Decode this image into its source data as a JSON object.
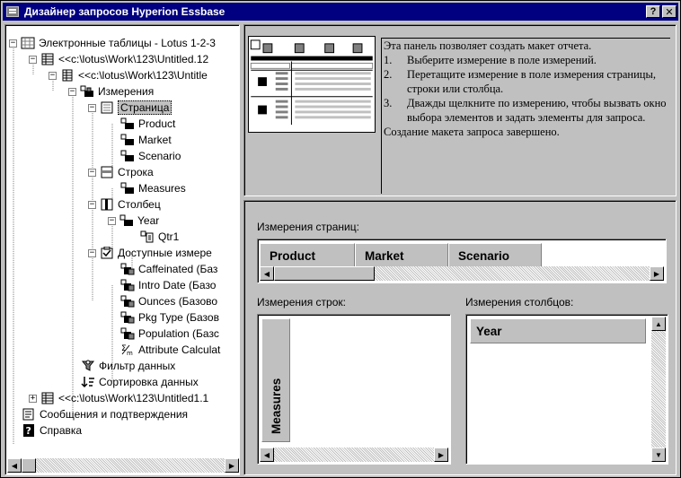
{
  "window": {
    "title": "Дизайнер запросов Hyperion Essbase",
    "help_button": "?",
    "close_button": "✕"
  },
  "tree": {
    "nodes": [
      {
        "label": "Электронные таблицы - Lotus 1-2-3",
        "icon": "spreadsheet-app-icon"
      },
      {
        "label": "<<c:\\lotus\\Work\\123\\Untitled.12",
        "icon": "workbook-icon"
      },
      {
        "label": "<<c:\\lotus\\Work\\123\\Untitle",
        "icon": "sheet-icon"
      },
      {
        "label": "Измерения",
        "icon": "dimensions-icon"
      },
      {
        "label": "Страница",
        "icon": "page-icon"
      },
      {
        "label": "Product",
        "icon": "dimension-icon"
      },
      {
        "label": "Market",
        "icon": "dimension-icon"
      },
      {
        "label": "Scenario",
        "icon": "dimension-icon"
      },
      {
        "label": "Строка",
        "icon": "row-icon"
      },
      {
        "label": "Measures",
        "icon": "dimension-icon"
      },
      {
        "label": "Столбец",
        "icon": "column-icon"
      },
      {
        "label": "Year",
        "icon": "dimension-icon"
      },
      {
        "label": "Qtr1",
        "icon": "member-icon"
      },
      {
        "label": "Доступные измере",
        "icon": "available-dimensions-icon"
      },
      {
        "label": "Caffeinated (Баз",
        "icon": "attribute-dimension-icon"
      },
      {
        "label": "Intro Date (Базо",
        "icon": "attribute-dimension-icon"
      },
      {
        "label": "Ounces (Базово",
        "icon": "attribute-dimension-icon"
      },
      {
        "label": "Pkg Type (Базов",
        "icon": "attribute-dimension-icon"
      },
      {
        "label": "Population (Базс",
        "icon": "attribute-dimension-icon"
      },
      {
        "label": "Attribute Calculat",
        "icon": "attribute-calculation-icon"
      },
      {
        "label": "Фильтр данных",
        "icon": "filter-icon"
      },
      {
        "label": "Сортировка данных",
        "icon": "sort-icon"
      },
      {
        "label": "<<c:\\lotus\\Work\\123\\Untitled1.1",
        "icon": "workbook-icon"
      },
      {
        "label": "Сообщения и подтверждения",
        "icon": "messages-icon"
      },
      {
        "label": "Справка",
        "icon": "help-icon"
      }
    ]
  },
  "help": {
    "intro": "Эта панель позволяет создать макет отчета.",
    "steps": [
      {
        "num": "1.",
        "text": "Выберите измерение в поле измерений."
      },
      {
        "num": "2.",
        "text": "Перетащите измерение в поле измерения страницы, строки или столбца."
      },
      {
        "num": "3.",
        "text": "Дважды щелкните по измерению, чтобы вызвать окно выбора элементов и задать элементы для запроса."
      }
    ],
    "outro": "Создание макета запроса завершено."
  },
  "layout": {
    "page_label": "Измерения страниц:",
    "page_dims": [
      "Product",
      "Market",
      "Scenario"
    ],
    "row_label": "Измерения строк:",
    "row_dims": [
      "Measures"
    ],
    "col_label": "Измерения столбцов:",
    "col_dims": [
      "Year"
    ]
  },
  "colors": {
    "titlebar": "#000080",
    "face": "#c0c0c0",
    "window_bg": "#ffffff"
  }
}
